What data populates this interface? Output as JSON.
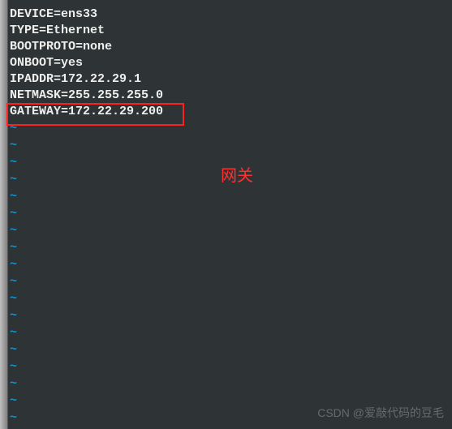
{
  "config": {
    "lines": [
      "DEVICE=ens33",
      "TYPE=Ethernet",
      "BOOTPROTO=none",
      "ONBOOT=yes",
      "IPADDR=172.22.29.1",
      "NETMASK=255.255.255.0",
      "GATEWAY=172.22.29.200"
    ]
  },
  "tilde": "~",
  "annotation": "网关",
  "watermark": "CSDN @爱敲代码的豆毛"
}
